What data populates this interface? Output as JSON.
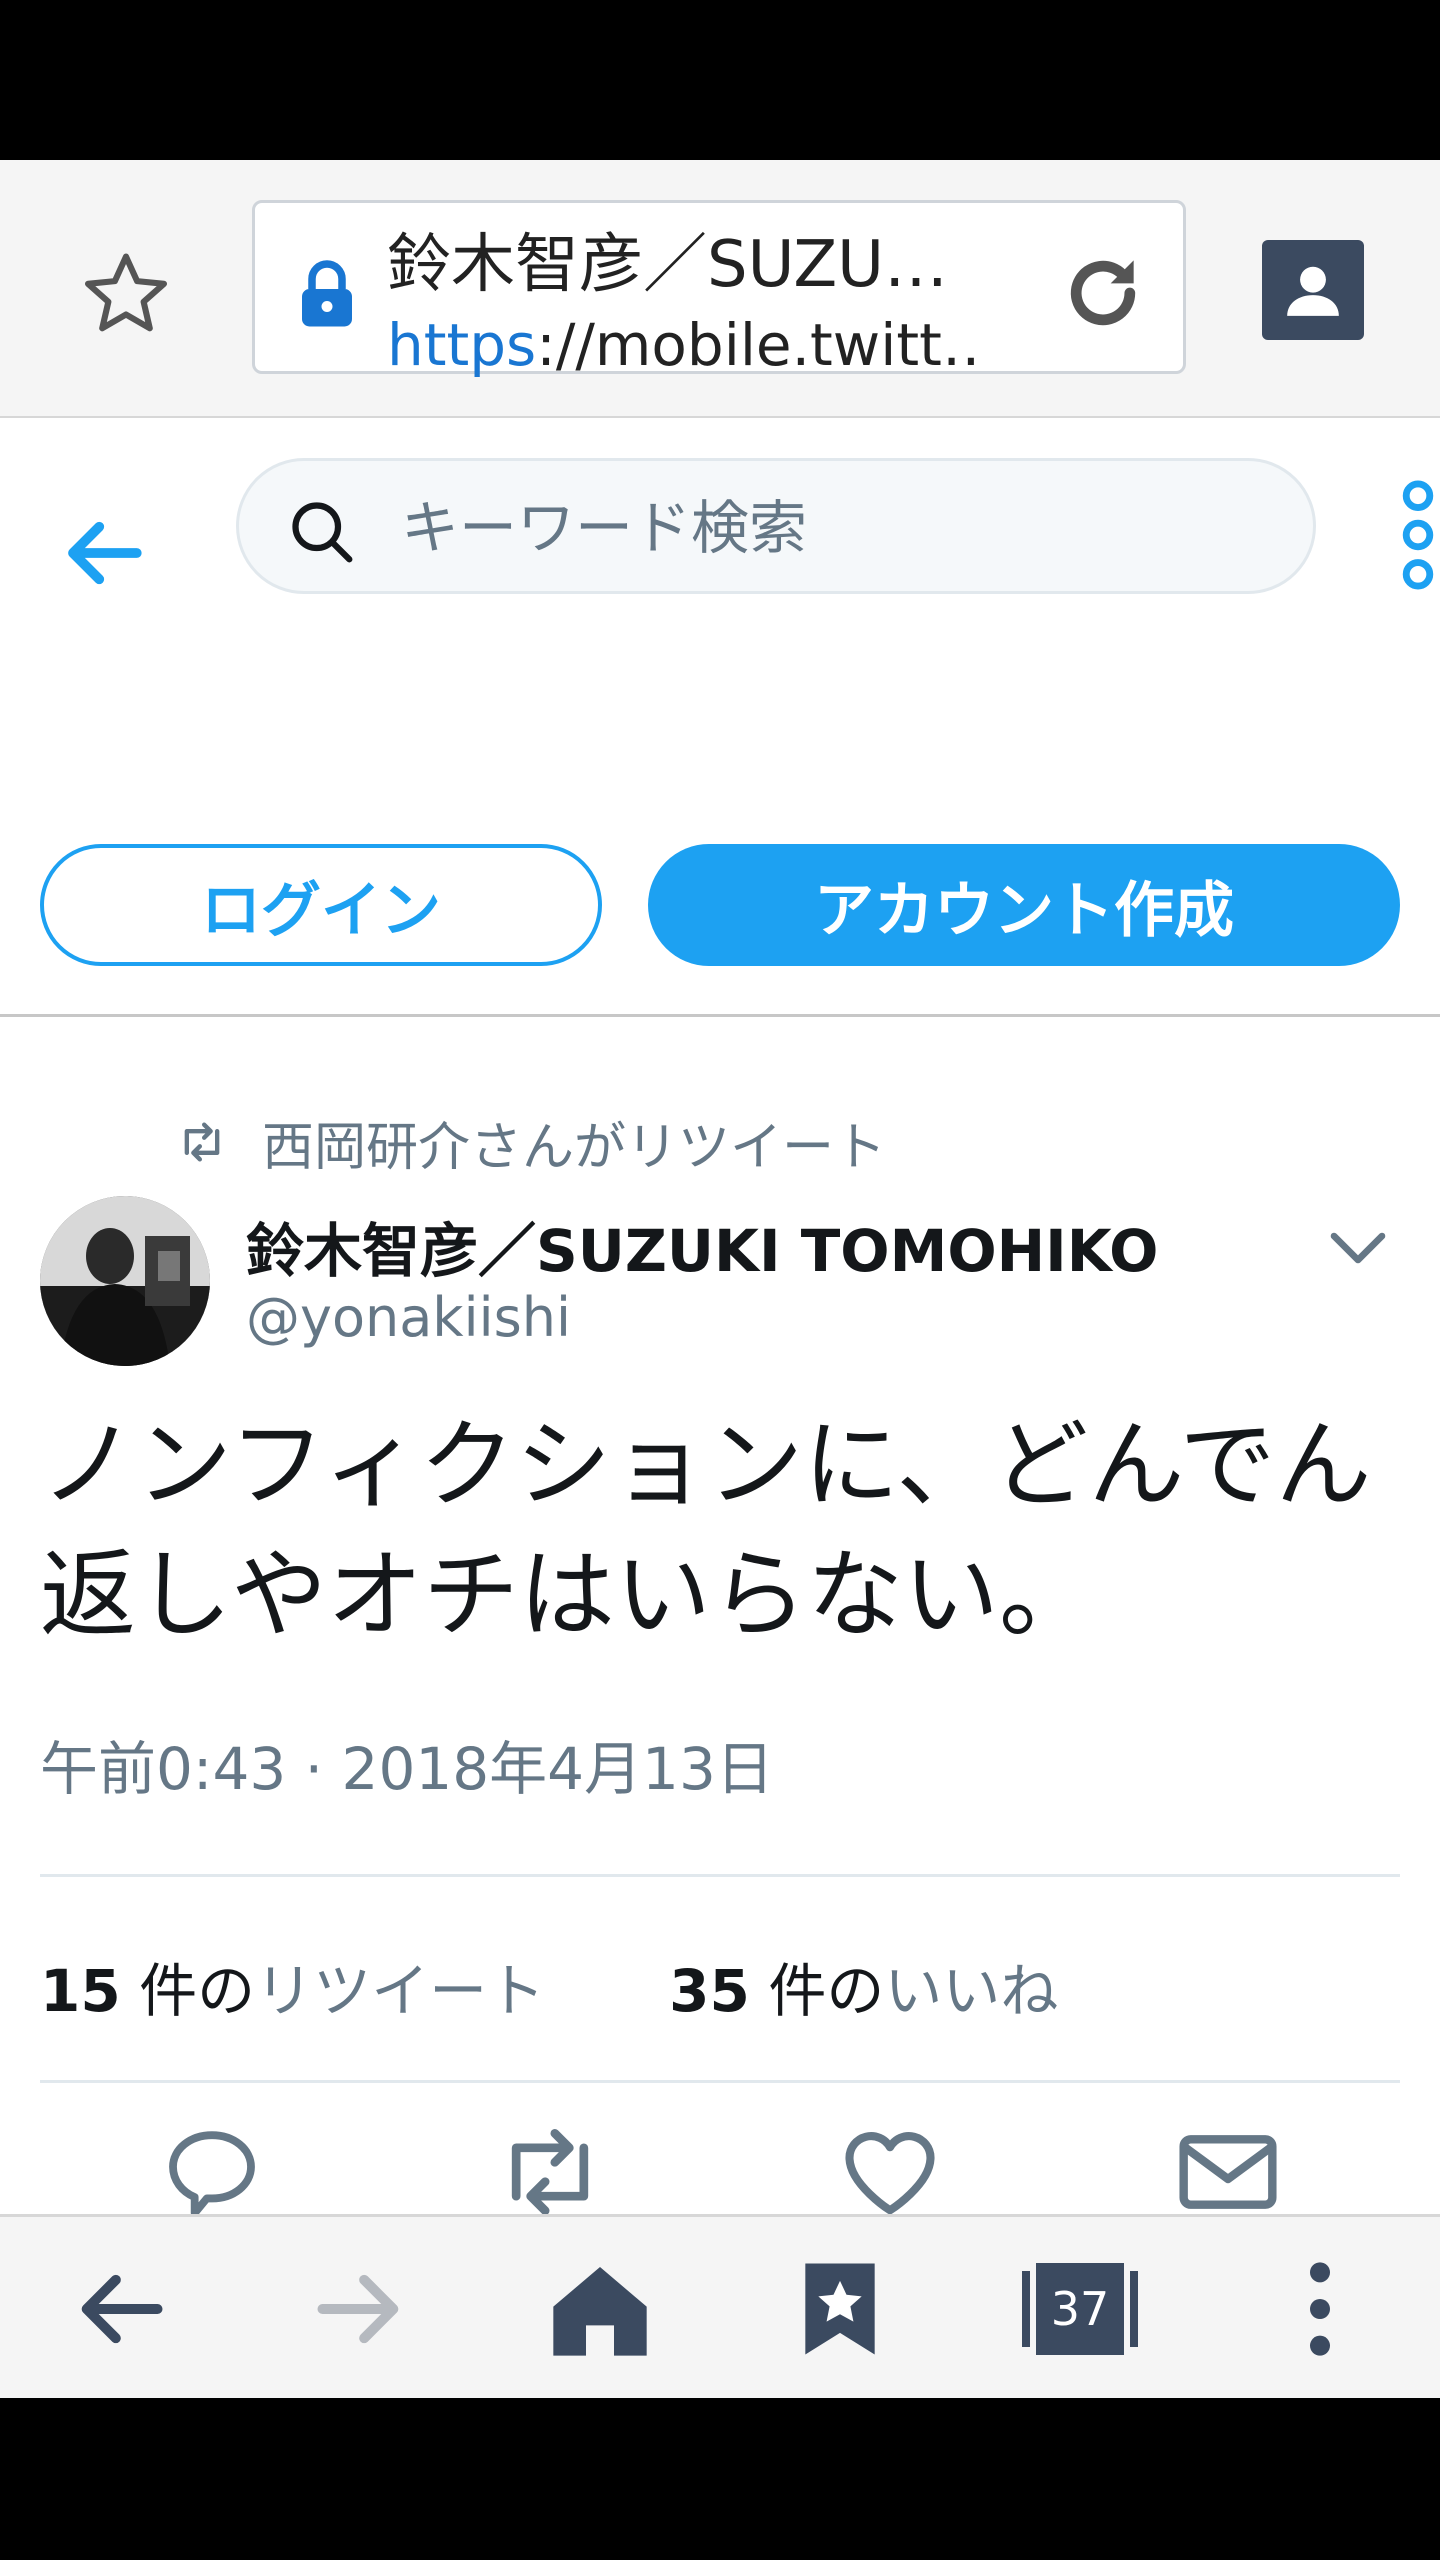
{
  "browser": {
    "page_title": "鈴木智彦／SUZU…",
    "url_scheme": "https",
    "url_rest": "://mobile.twitt…",
    "tab_count": "37"
  },
  "header": {
    "search_placeholder": "キーワード検索",
    "login_label": "ログイン",
    "signup_label": "アカウント作成"
  },
  "tweet": {
    "retweeted_by": "西岡研介さんがリツイート",
    "author_name": "鈴木智彦／SUZUKI TOMOHIKO",
    "author_handle": "@yonakiishi",
    "text_line1": "ノンフィクションに、どんでん",
    "text_line2": "返しやオチはいらない。",
    "timestamp": "午前0:43 · 2018年4月13日",
    "retweet_count": "15",
    "retweet_word": " 件の",
    "retweet_link": "リツイート",
    "like_count": "35",
    "like_word": " 件の",
    "like_link": "いいね"
  },
  "colors": {
    "twitter_blue": "#1da1f2",
    "secondary_text": "#657786",
    "toolbar_icon": "#3b4a60"
  },
  "icons": [
    "star-icon",
    "lock-icon",
    "reload-icon",
    "account-icon",
    "back-arrow-icon",
    "search-icon",
    "more-vertical-icon",
    "retweet-icon",
    "chevron-down-icon",
    "reply-icon",
    "like-icon",
    "message-icon",
    "forward-arrow-icon",
    "home-icon",
    "bookmark-icon",
    "tabs-icon"
  ]
}
